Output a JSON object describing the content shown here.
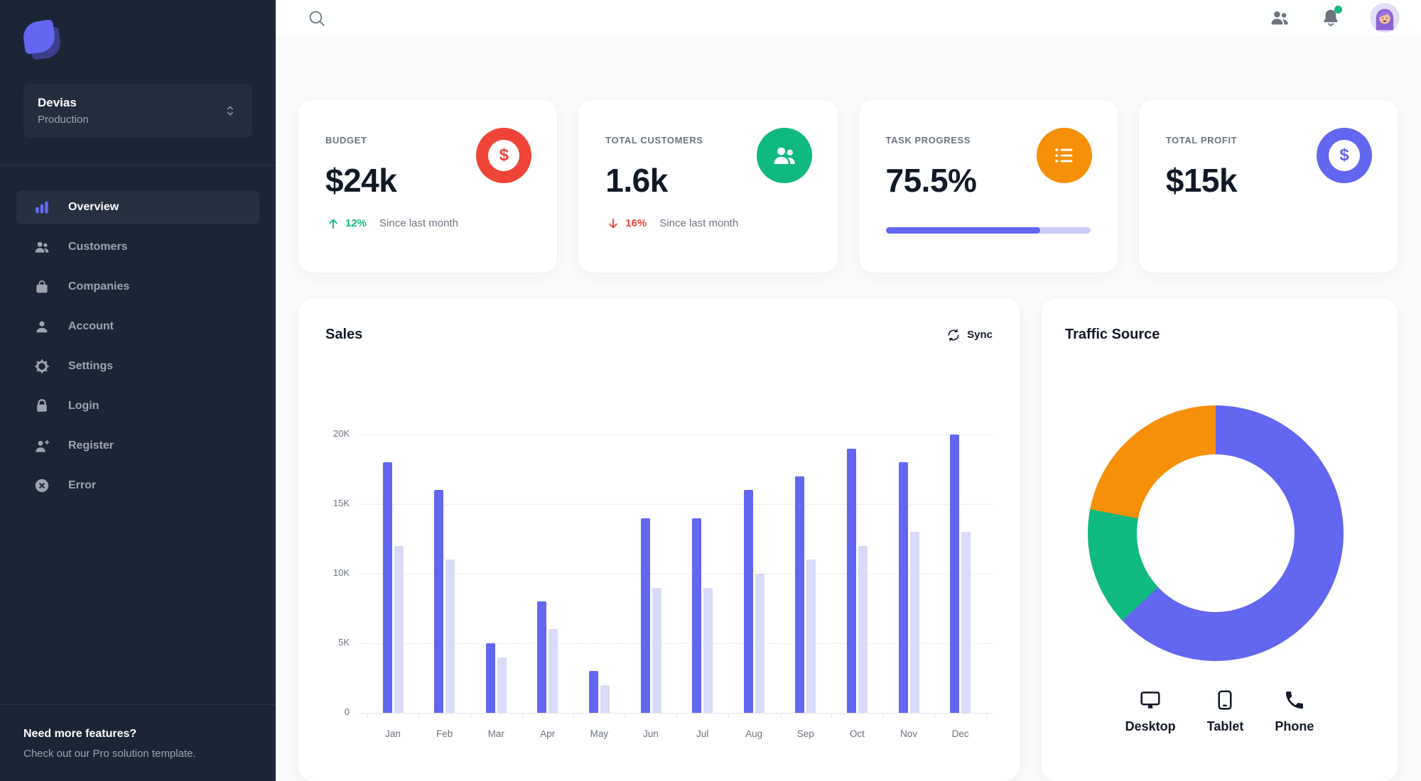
{
  "colors": {
    "accent": "#6366F1",
    "bar_light": "#D9DBF9",
    "green": "#10B981",
    "red": "#F04438",
    "orange": "#F79009",
    "sidebar_bg": "#1C2536",
    "text_dark": "#111927",
    "text_muted": "#6C737F",
    "sidebar_text": "#9DA4AE",
    "notification_dot": "#10B981",
    "donut_colors": [
      "#6366F1",
      "#10B981",
      "#F79009"
    ]
  },
  "sidebar": {
    "workspace": {
      "name": "Devias",
      "env": "Production"
    },
    "items": [
      {
        "label": "Overview",
        "icon": "bar-chart",
        "active": true
      },
      {
        "label": "Customers",
        "icon": "users",
        "active": false
      },
      {
        "label": "Companies",
        "icon": "shopping-bag",
        "active": false
      },
      {
        "label": "Account",
        "icon": "user",
        "active": false
      },
      {
        "label": "Settings",
        "icon": "gear",
        "active": false
      },
      {
        "label": "Login",
        "icon": "lock",
        "active": false
      },
      {
        "label": "Register",
        "icon": "user-plus",
        "active": false
      },
      {
        "label": "Error",
        "icon": "x-circle",
        "active": false
      }
    ],
    "footer": {
      "title": "Need more features?",
      "subtitle": "Check out our Pro solution template."
    }
  },
  "topbar": {
    "icons": [
      "search",
      "contacts",
      "notifications",
      "avatar"
    ],
    "notification_dot": true
  },
  "stats": [
    {
      "label": "BUDGET",
      "value": "$24k",
      "icon": "currency-dollar",
      "icon_bg": "#F04438",
      "delta": {
        "dir": "up",
        "value": "12%",
        "caption": "Since last month"
      }
    },
    {
      "label": "TOTAL CUSTOMERS",
      "value": "1.6k",
      "icon": "users",
      "icon_bg": "#10B981",
      "delta": {
        "dir": "down",
        "value": "16%",
        "caption": "Since last month"
      }
    },
    {
      "label": "TASK PROGRESS",
      "value": "75.5%",
      "icon": "list-bullet",
      "icon_bg": "#F79009",
      "progress_pct": 75.5
    },
    {
      "label": "TOTAL PROFIT",
      "value": "$15k",
      "icon": "currency-dollar",
      "icon_bg": "#6366F1"
    }
  ],
  "sales": {
    "title": "Sales",
    "sync_label": "Sync"
  },
  "traffic": {
    "title": "Traffic Source",
    "legend": [
      {
        "label": "Desktop",
        "icon": "desktop"
      },
      {
        "label": "Tablet",
        "icon": "tablet"
      },
      {
        "label": "Phone",
        "icon": "phone"
      }
    ]
  },
  "chart_data": [
    {
      "type": "bar",
      "title": "Sales",
      "categories": [
        "Jan",
        "Feb",
        "Mar",
        "Apr",
        "May",
        "Jun",
        "Jul",
        "Aug",
        "Sep",
        "Oct",
        "Nov",
        "Dec"
      ],
      "series": [
        {
          "name": "series-dark",
          "values": [
            18,
            16,
            5,
            8,
            3,
            14,
            14,
            16,
            17,
            19,
            18,
            20
          ]
        },
        {
          "name": "series-light",
          "values": [
            12,
            11,
            4,
            6,
            2,
            9,
            9,
            10,
            11,
            12,
            13,
            13
          ]
        }
      ],
      "xlabel": "",
      "ylabel": "",
      "ylim": [
        0,
        20
      ],
      "ytick_values": [
        0,
        5,
        10,
        15,
        20
      ],
      "ytick_labels": [
        "0",
        "5K",
        "10K",
        "15K",
        "20K"
      ],
      "grid": true,
      "legend_position": "none",
      "unit": "K"
    },
    {
      "type": "pie",
      "title": "Traffic Source",
      "labels": [
        "Desktop",
        "Tablet",
        "Phone"
      ],
      "values": [
        63,
        15,
        22
      ],
      "donut": true,
      "legend_position": "bottom"
    }
  ]
}
